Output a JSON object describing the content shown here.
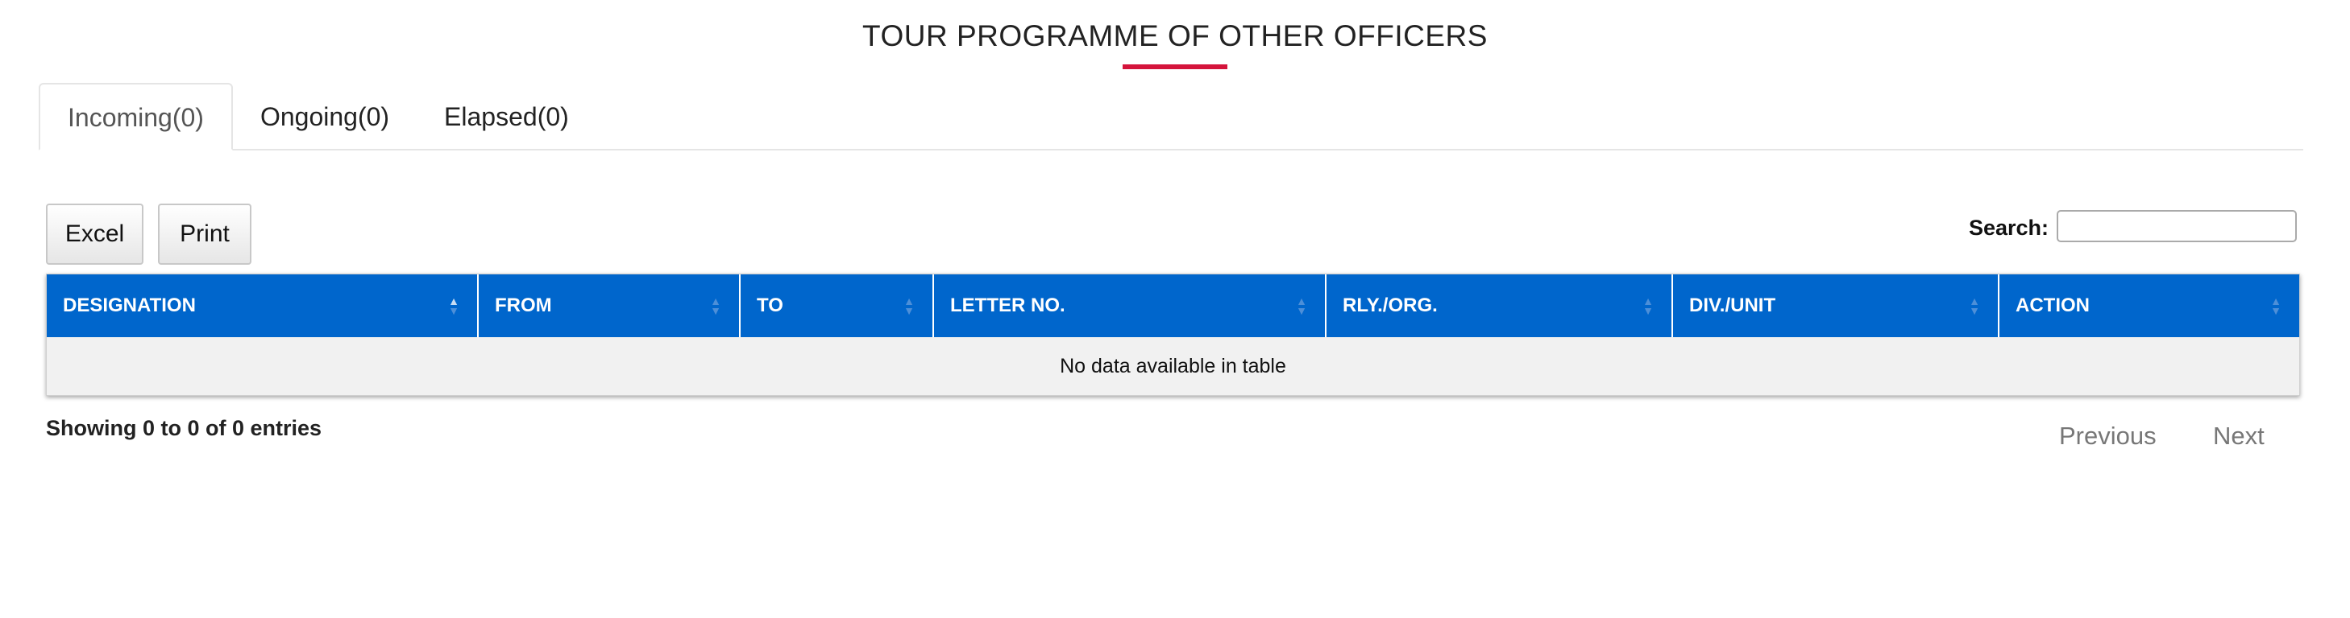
{
  "page": {
    "title": "TOUR PROGRAMME OF OTHER OFFICERS",
    "accent_color": "#d4143b",
    "header_color": "#0066cc"
  },
  "tabs": [
    {
      "label": "Incoming(0)",
      "active": true
    },
    {
      "label": "Ongoing(0)",
      "active": false
    },
    {
      "label": "Elapsed(0)",
      "active": false
    }
  ],
  "toolbar": {
    "excel_label": "Excel",
    "print_label": "Print",
    "search_label": "Search:",
    "search_value": ""
  },
  "table": {
    "columns": [
      "DESIGNATION",
      "FROM",
      "TO",
      "LETTER NO.",
      "RLY./ORG.",
      "DIV./UNIT",
      "ACTION"
    ],
    "empty_message": "No data available in table"
  },
  "footer": {
    "info": "Showing 0 to 0 of 0 entries",
    "previous_label": "Previous",
    "next_label": "Next"
  }
}
